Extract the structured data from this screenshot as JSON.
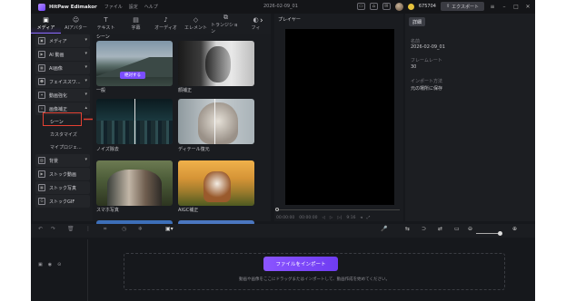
{
  "app": {
    "name": "HitPaw Edimakor",
    "menu": [
      "ファイル",
      "設定",
      "ヘルプ"
    ],
    "document_title": "2026-02-09_01",
    "credits": "675704",
    "export_label": "エクスポート"
  },
  "toolbar": {
    "tabs": [
      {
        "label": "メディア",
        "icon": "folder-icon"
      },
      {
        "label": "AIアバター",
        "icon": "ai-avatar-icon"
      },
      {
        "label": "テキスト",
        "icon": "text-icon"
      },
      {
        "label": "字幕",
        "icon": "subtitle-icon"
      },
      {
        "label": "オーディオ",
        "icon": "music-icon"
      },
      {
        "label": "エレメント",
        "icon": "element-icon"
      },
      {
        "label": "トランジション",
        "icon": "transition-icon"
      },
      {
        "label": "フィ",
        "icon": "filter-icon"
      }
    ]
  },
  "sidebar": {
    "items": [
      {
        "label": "メディア"
      },
      {
        "label": "AI 動画"
      },
      {
        "label": "AI画像"
      },
      {
        "label": "フェイススワ..."
      },
      {
        "label": "動画強化"
      },
      {
        "label": "画像補正"
      }
    ],
    "sub_items": [
      "シーン",
      "カスタマイズ",
      "マイプロジェ..."
    ],
    "bottom_items": [
      {
        "label": "背景"
      },
      {
        "label": "ストック動画"
      },
      {
        "label": "ストック写真"
      },
      {
        "label": "ストックGIF"
      }
    ]
  },
  "media": {
    "section_title": "シーン",
    "create_label": "絶対する",
    "thumbnails": [
      {
        "caption": "一般"
      },
      {
        "caption": "顔補正"
      },
      {
        "caption": "ノイズ除去"
      },
      {
        "caption": "ディテール復元"
      },
      {
        "caption": "スマホ写真"
      },
      {
        "caption": "AIGC補正"
      }
    ]
  },
  "player": {
    "title": "プレイヤー",
    "time_current": "00:00:00",
    "time_total": "00:00:00",
    "ratio": "9:16"
  },
  "properties": {
    "tab": "詳細",
    "fields": [
      {
        "label": "名前",
        "value": "2026-02-09_01"
      },
      {
        "label": "フレームレート",
        "value": "30"
      },
      {
        "label": "インポート方法",
        "value": "元の場所に保存"
      }
    ]
  },
  "timeline": {
    "import_label": "ファイルをインポート",
    "drop_hint": "動画や画像をここにドラッグまたはインポートして、動画作成を始めてください。"
  },
  "colors": {
    "accent": "#7b4dff",
    "highlight": "#e54132"
  }
}
